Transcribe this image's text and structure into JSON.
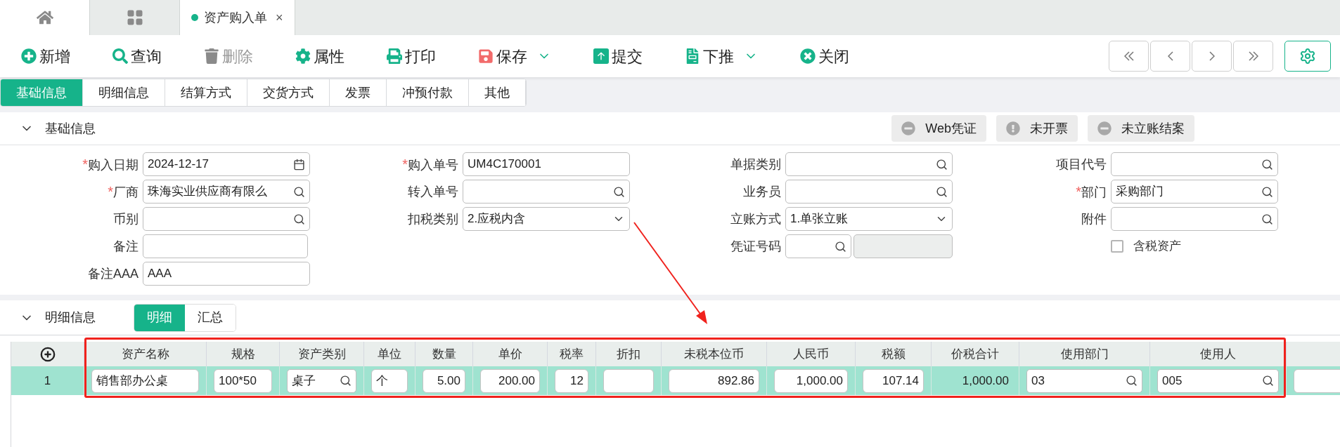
{
  "top_tabs": [
    {
      "kind": "home",
      "selected": false
    },
    {
      "kind": "apps",
      "selected": false
    },
    {
      "kind": "document",
      "label": "资产购入单",
      "close_mark": "×",
      "selected": true
    }
  ],
  "toolbar": [
    {
      "kind": "plus",
      "label": "新增",
      "disabled": false,
      "dropdown": false
    },
    {
      "kind": "search",
      "label": "查询",
      "disabled": false,
      "dropdown": false
    },
    {
      "kind": "trash",
      "label": "删除",
      "disabled": true,
      "dropdown": false
    },
    {
      "kind": "gear",
      "label": "属性",
      "disabled": false,
      "dropdown": false
    },
    {
      "kind": "print",
      "label": "打印",
      "disabled": false,
      "dropdown": false
    },
    {
      "kind": "save",
      "label": "保存",
      "disabled": false,
      "dropdown": true
    },
    {
      "kind": "submit",
      "label": "提交",
      "disabled": false,
      "dropdown": false
    },
    {
      "kind": "push",
      "label": "下推",
      "disabled": false,
      "dropdown": true
    },
    {
      "kind": "close",
      "label": "关闭",
      "disabled": false,
      "dropdown": false
    }
  ],
  "section_tabs": [
    {
      "label": "基础信息",
      "selected": true
    },
    {
      "label": "明细信息",
      "selected": false
    },
    {
      "label": "结算方式",
      "selected": false
    },
    {
      "label": "交货方式",
      "selected": false
    },
    {
      "label": "发票",
      "selected": false
    },
    {
      "label": "冲预付款",
      "selected": false
    },
    {
      "label": "其他",
      "selected": false
    }
  ],
  "basic_section": {
    "title": "基础信息",
    "expanded": true,
    "status_buttons": [
      {
        "kind": "minus",
        "label": "Web凭证"
      },
      {
        "kind": "exclamation",
        "label": "未开票"
      },
      {
        "kind": "minus",
        "label": "未立账结案"
      }
    ],
    "form_rows": [
      [
        {
          "label": "购入日期",
          "required_mark": "*",
          "kind": "date",
          "value": "2024-12-17"
        },
        {
          "label": "购入单号",
          "required_mark": "*",
          "kind": "text",
          "value": "UM4C170001"
        },
        {
          "label": "单据类别",
          "kind": "lookup"
        },
        {
          "label": "项目代号",
          "kind": "lookup"
        }
      ],
      [
        {
          "label": "厂商",
          "required_mark": "*",
          "kind": "lookup",
          "value": "珠海实业供应商有限么"
        },
        {
          "label": "转入单号",
          "kind": "lookup"
        },
        {
          "label": "业务员",
          "kind": "lookup"
        },
        {
          "label": "部门",
          "required_mark": "*",
          "kind": "lookup",
          "value": "采购部门"
        }
      ],
      [
        {
          "label": "币别",
          "kind": "lookup"
        },
        {
          "label": "扣税类别",
          "kind": "select",
          "value": "2.应税内含"
        },
        {
          "label": "立账方式",
          "kind": "select",
          "value": "1.单张立账"
        },
        {
          "label": "附件",
          "kind": "lookup"
        }
      ],
      [
        {
          "label": "备注",
          "kind": "note"
        },
        {
          "label": "凭证号码",
          "kind": "voucher"
        },
        {
          "label": "含税资产",
          "kind": "checkbox",
          "checked": false
        }
      ],
      [
        {
          "label": "备注AAA",
          "kind": "text",
          "value": "AAA"
        }
      ]
    ]
  },
  "detail_section": {
    "title": "明细信息",
    "expanded": true,
    "views": [
      {
        "label": "明细",
        "selected": true
      },
      {
        "label": "汇总",
        "selected": false
      }
    ],
    "table": {
      "columns": [
        "资产名称",
        "规格",
        "资产类别",
        "单位",
        "数量",
        "单价",
        "税率",
        "折扣",
        "未税本位币",
        "人民币",
        "税额",
        "价税合计",
        "使用部门",
        "使用人"
      ],
      "rows": [
        {
          "number": "1",
          "selected": true,
          "cells": [
            {
              "kind": "text",
              "value": "销售部办公桌"
            },
            {
              "kind": "text",
              "value": "100*50"
            },
            {
              "kind": "lookup",
              "value": "桌子"
            },
            {
              "kind": "text",
              "value": "个"
            },
            {
              "kind": "number",
              "value": "5.00"
            },
            {
              "kind": "number",
              "value": "200.00"
            },
            {
              "kind": "number",
              "value": "12"
            },
            {
              "kind": "number"
            },
            {
              "kind": "number",
              "value": "892.86"
            },
            {
              "kind": "number",
              "value": "1,000.00"
            },
            {
              "kind": "number",
              "value": "107.14"
            },
            {
              "kind": "plain",
              "value": "1,000.00"
            },
            {
              "kind": "lookup",
              "value": "03"
            },
            {
              "kind": "lookup",
              "value": "005"
            }
          ]
        }
      ]
    }
  }
}
